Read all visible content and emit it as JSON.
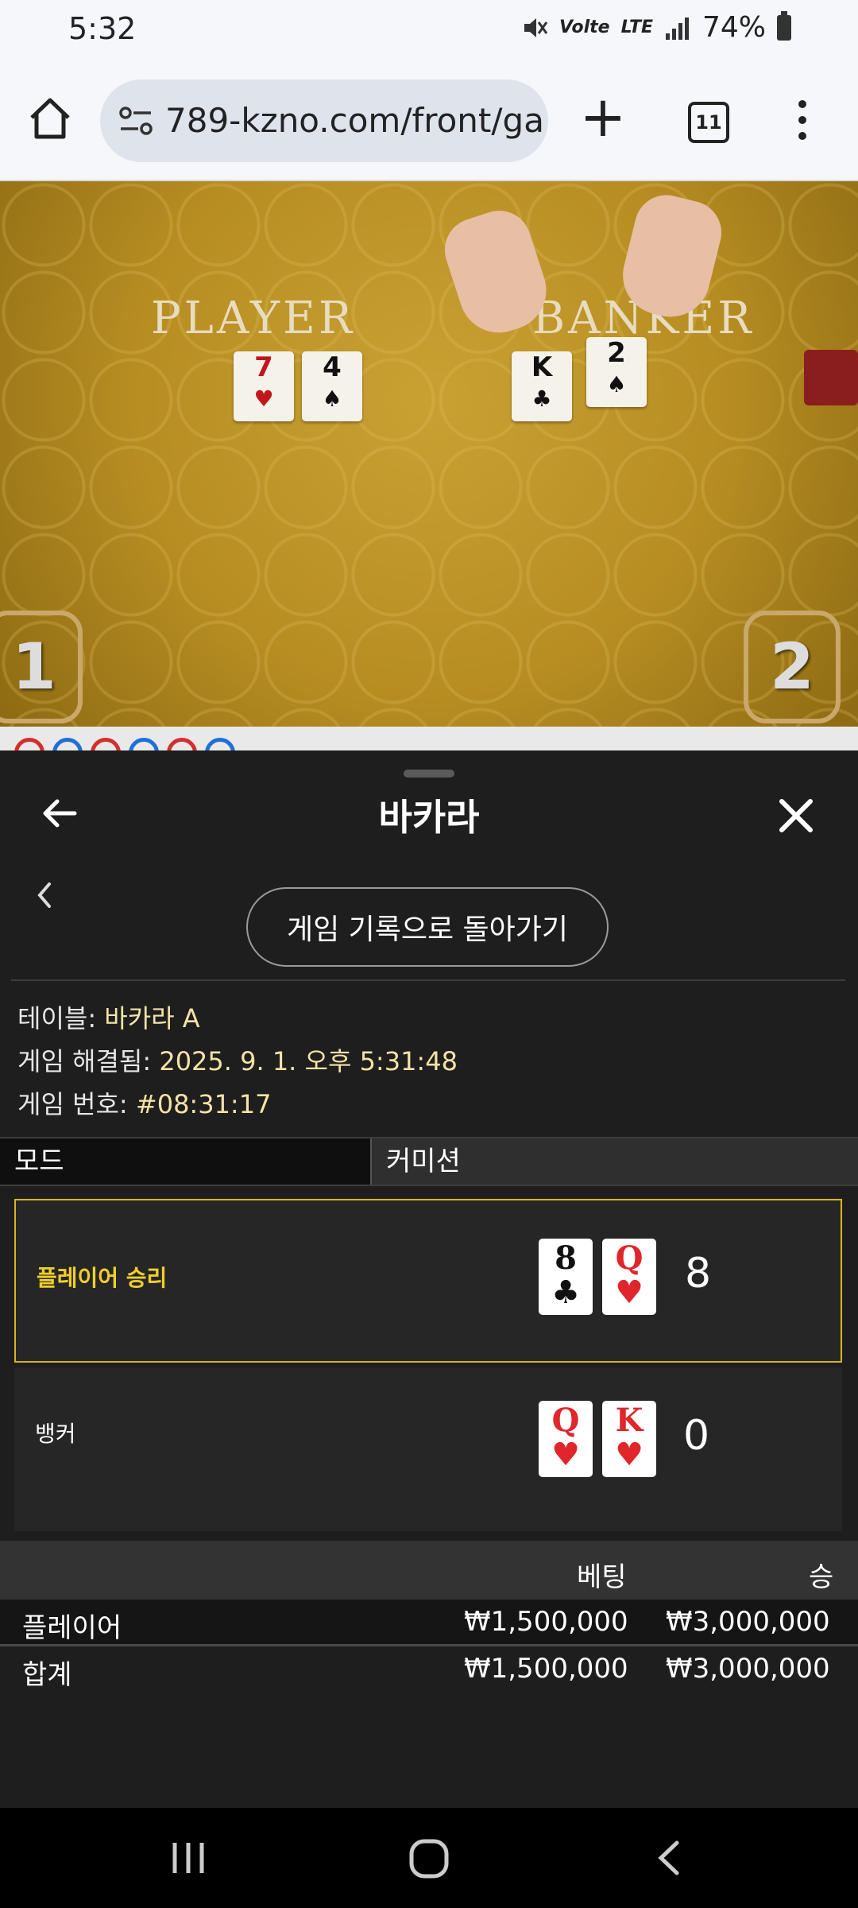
{
  "status_bar": {
    "time": "5:32",
    "network": "LTE",
    "volte": "Volte",
    "battery": "74%"
  },
  "browser": {
    "url": "789-kzno.com/front/ga",
    "tab_count": "11"
  },
  "video": {
    "player_label": "PLAYER",
    "banker_label": "BANKER",
    "seat_left": "1",
    "seat_right": "2",
    "player_cards": [
      {
        "rank": "7",
        "suit": "♥"
      },
      {
        "rank": "4",
        "suit": "♠"
      }
    ],
    "banker_cards": [
      {
        "rank": "K",
        "suit": "♣"
      },
      {
        "rank": "2",
        "suit": "♠"
      }
    ]
  },
  "sheet": {
    "title": "바카라",
    "history_button": "게임 기록으로 돌아가기",
    "table_label": "테이블:",
    "table_value": "바카라 A",
    "resolved_label": "게임 해결됨:",
    "resolved_value": "2025. 9. 1. 오후 5:31:48",
    "game_no_label": "게임 번호:",
    "game_no_value": "#08:31:17",
    "mode_tabs": [
      "모드",
      "커미션"
    ],
    "results": [
      {
        "label": "플레이어 승리",
        "score": "8",
        "cards": [
          {
            "rank": "8",
            "suit": "♣"
          },
          {
            "rank": "Q",
            "suit": "♥"
          }
        ]
      },
      {
        "label": "뱅커",
        "score": "0",
        "cards": [
          {
            "rank": "Q",
            "suit": "♥"
          },
          {
            "rank": "K",
            "suit": "♥"
          }
        ]
      }
    ],
    "bet_table": {
      "headers": {
        "bet": "베팅",
        "win": "승"
      },
      "rows": [
        {
          "name": "플레이어",
          "bet": "₩1,500,000",
          "win": "₩3,000,000"
        },
        {
          "name": "합계",
          "bet": "₩1,500,000",
          "win": "₩3,000,000"
        }
      ]
    }
  },
  "colors": {
    "accent": "#f0cf2c",
    "sheet_bg": "#1e1e1e",
    "felt": "#b78d22"
  }
}
